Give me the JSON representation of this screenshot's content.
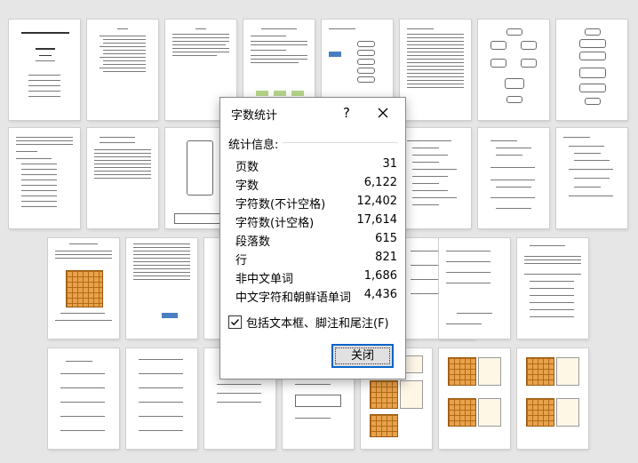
{
  "dialog": {
    "title": "字数统计",
    "help_label": "?",
    "section_label": "统计信息:",
    "stats": [
      {
        "label": "页数",
        "value": "31"
      },
      {
        "label": "字数",
        "value": "6,122"
      },
      {
        "label": "字符数(不计空格)",
        "value": "12,402"
      },
      {
        "label": "字符数(计空格)",
        "value": "17,614"
      },
      {
        "label": "段落数",
        "value": "615"
      },
      {
        "label": "行",
        "value": "821"
      },
      {
        "label": "非中文单词",
        "value": "1,686"
      },
      {
        "label": "中文字符和朝鲜语单词",
        "value": "4,436"
      }
    ],
    "include_checkbox": {
      "label": "包括文本框、脚注和尾注(F)",
      "checked": true
    },
    "close_button": "关闭"
  },
  "colors": {
    "accent": "#0a64c8",
    "background": "#e6e6e6"
  },
  "icons": [
    "close-icon",
    "checkmark-icon"
  ]
}
